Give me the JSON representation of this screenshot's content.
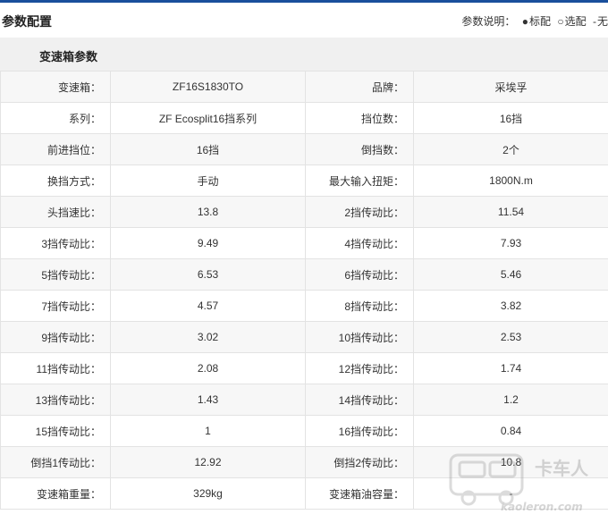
{
  "header": {
    "title": "参数配置",
    "legend_label": "参数说明：",
    "legend": [
      {
        "symbol": "●",
        "label": "标配"
      },
      {
        "symbol": "○",
        "label": "选配"
      },
      {
        "symbol": "-",
        "label": "无"
      }
    ]
  },
  "section": {
    "title": "变速箱参数"
  },
  "rows": [
    {
      "l1": "变速箱：",
      "v1": "ZF16S1830TO",
      "l2": "品牌：",
      "v2": "采埃孚"
    },
    {
      "l1": "系列：",
      "v1": "ZF Ecosplit16挡系列",
      "l2": "挡位数：",
      "v2": "16挡"
    },
    {
      "l1": "前进挡位：",
      "v1": "16挡",
      "l2": "倒挡数：",
      "v2": "2个"
    },
    {
      "l1": "换挡方式：",
      "v1": "手动",
      "l2": "最大输入扭矩：",
      "v2": "1800N.m"
    },
    {
      "l1": "头挡速比：",
      "v1": "13.8",
      "l2": "2挡传动比：",
      "v2": "11.54"
    },
    {
      "l1": "3挡传动比：",
      "v1": "9.49",
      "l2": "4挡传动比：",
      "v2": "7.93"
    },
    {
      "l1": "5挡传动比：",
      "v1": "6.53",
      "l2": "6挡传动比：",
      "v2": "5.46"
    },
    {
      "l1": "7挡传动比：",
      "v1": "4.57",
      "l2": "8挡传动比：",
      "v2": "3.82"
    },
    {
      "l1": "9挡传动比：",
      "v1": "3.02",
      "l2": "10挡传动比：",
      "v2": "2.53"
    },
    {
      "l1": "11挡传动比：",
      "v1": "2.08",
      "l2": "12挡传动比：",
      "v2": "1.74"
    },
    {
      "l1": "13挡传动比：",
      "v1": "1.43",
      "l2": "14挡传动比：",
      "v2": "1.2"
    },
    {
      "l1": "15挡传动比：",
      "v1": "1",
      "l2": "16挡传动比：",
      "v2": "0.84"
    },
    {
      "l1": "倒挡1传动比：",
      "v1": "12.92",
      "l2": "倒挡2传动比：",
      "v2": "10.8"
    },
    {
      "l1": "变速箱重量：",
      "v1": "329kg",
      "l2": "变速箱油容量：",
      "v2": "-"
    }
  ],
  "watermark": {
    "text": "卡车人",
    "subtext": "kaoleron.com",
    "icon": "truck-icon"
  },
  "colors": {
    "accent": "#1a4f9c",
    "row_alt": "#f7f7f7",
    "border": "#e3e3e3"
  }
}
